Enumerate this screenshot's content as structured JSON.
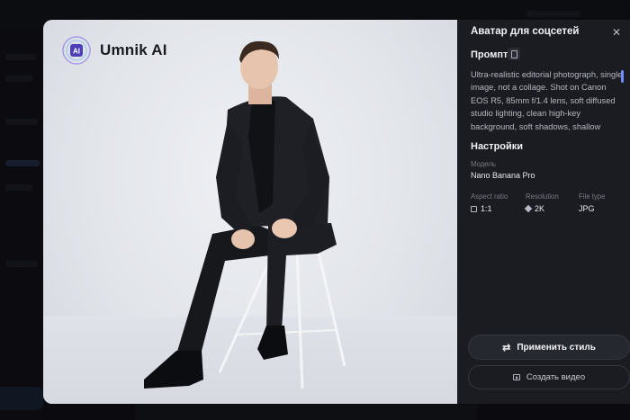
{
  "modal": {
    "title": "Аватар для соцсетей",
    "close_icon": "close-icon"
  },
  "watermark": {
    "logo_text": "Umnik AI",
    "logo_badge": "AI"
  },
  "prompt": {
    "label": "Промпт",
    "copy_icon": "copy-icon",
    "text": "Ultra-realistic editorial photograph, single image, not a collage. Shot on Canon EOS R5, 85mm f/1.4 lens, soft diffused studio lighting, clean high-key background, soft shadows, shallow"
  },
  "settings": {
    "label": "Настройки",
    "model_label": "Модель",
    "model_value": "Nano Banana Pro",
    "aspect_label": "Aspect ratio",
    "aspect_value": "1:1",
    "resolution_label": "Resolution",
    "resolution_value": "2K",
    "filetype_label": "File type",
    "filetype_value": "JPG"
  },
  "actions": {
    "apply_style": "Применить стиль",
    "create_video": "Создать видео"
  },
  "colors": {
    "panel_bg": "#1b1c21",
    "accent": "#6f8bff",
    "photo_bg": "#e6e8ed"
  }
}
